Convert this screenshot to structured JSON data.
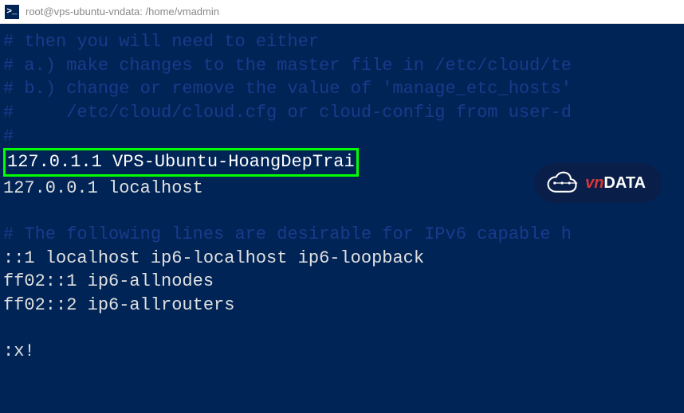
{
  "title_bar": {
    "icon_symbol": ">_",
    "title": "root@vps-ubuntu-vndata: /home/vmadmin"
  },
  "terminal": {
    "lines": {
      "c1": "# then you will need to either",
      "c2": "# a.) make changes to the master file in /etc/cloud/te",
      "c3": "# b.) change or remove the value of 'manage_etc_hosts'",
      "c4": "#     /etc/cloud/cloud.cfg or cloud-config from user-d",
      "c5": "#",
      "highlighted": "127.0.1.1 VPS-Ubuntu-HoangDepTrai",
      "l1": "127.0.0.1 localhost",
      "c6": "# The following lines are desirable for IPv6 capable h",
      "l2": "::1 localhost ip6-localhost ip6-loopback",
      "l3": "ff02::1 ip6-allnodes",
      "l4": "ff02::2 ip6-allrouters",
      "command": ":x!"
    }
  },
  "logo": {
    "vn": "vn",
    "data": "DATA"
  }
}
